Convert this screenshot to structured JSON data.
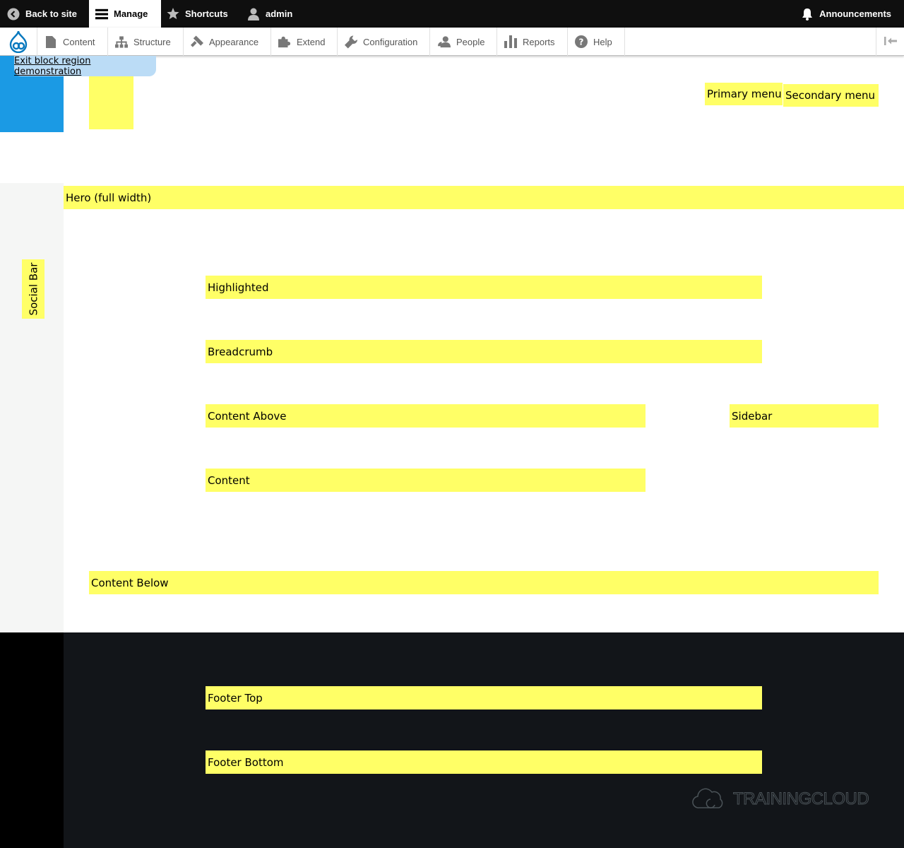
{
  "toolbar": {
    "back_to_site": "Back to site",
    "manage": "Manage",
    "shortcuts": "Shortcuts",
    "user": "admin",
    "announcements": "Announcements"
  },
  "tray": {
    "items": [
      {
        "label": "Content",
        "icon": "file-icon"
      },
      {
        "label": "Structure",
        "icon": "sitemap-icon"
      },
      {
        "label": "Appearance",
        "icon": "paint-roller-icon"
      },
      {
        "label": "Extend",
        "icon": "puzzle-icon"
      },
      {
        "label": "Configuration",
        "icon": "wrench-icon"
      },
      {
        "label": "People",
        "icon": "person-icon"
      },
      {
        "label": "Reports",
        "icon": "bar-chart-icon"
      },
      {
        "label": "Help",
        "icon": "question-icon"
      }
    ]
  },
  "page": {
    "exit_demo": "Exit block region demonstration",
    "regions": {
      "primary_menu": "Primary menu",
      "secondary_menu": "Secondary menu",
      "hero": "Hero (full width)",
      "social_bar": "Social Bar",
      "highlighted": "Highlighted",
      "breadcrumb": "Breadcrumb",
      "content_above": "Content Above",
      "sidebar": "Sidebar",
      "content": "Content",
      "content_below": "Content Below",
      "footer_top": "Footer Top",
      "footer_bottom": "Footer Bottom"
    },
    "brand": "TRAININGCLOUD"
  },
  "colors": {
    "region_highlight": "#ffff66",
    "toolbar_bg": "#0f0f0f",
    "blue_block": "#1b9ae4",
    "footer_bg": "#121519"
  }
}
